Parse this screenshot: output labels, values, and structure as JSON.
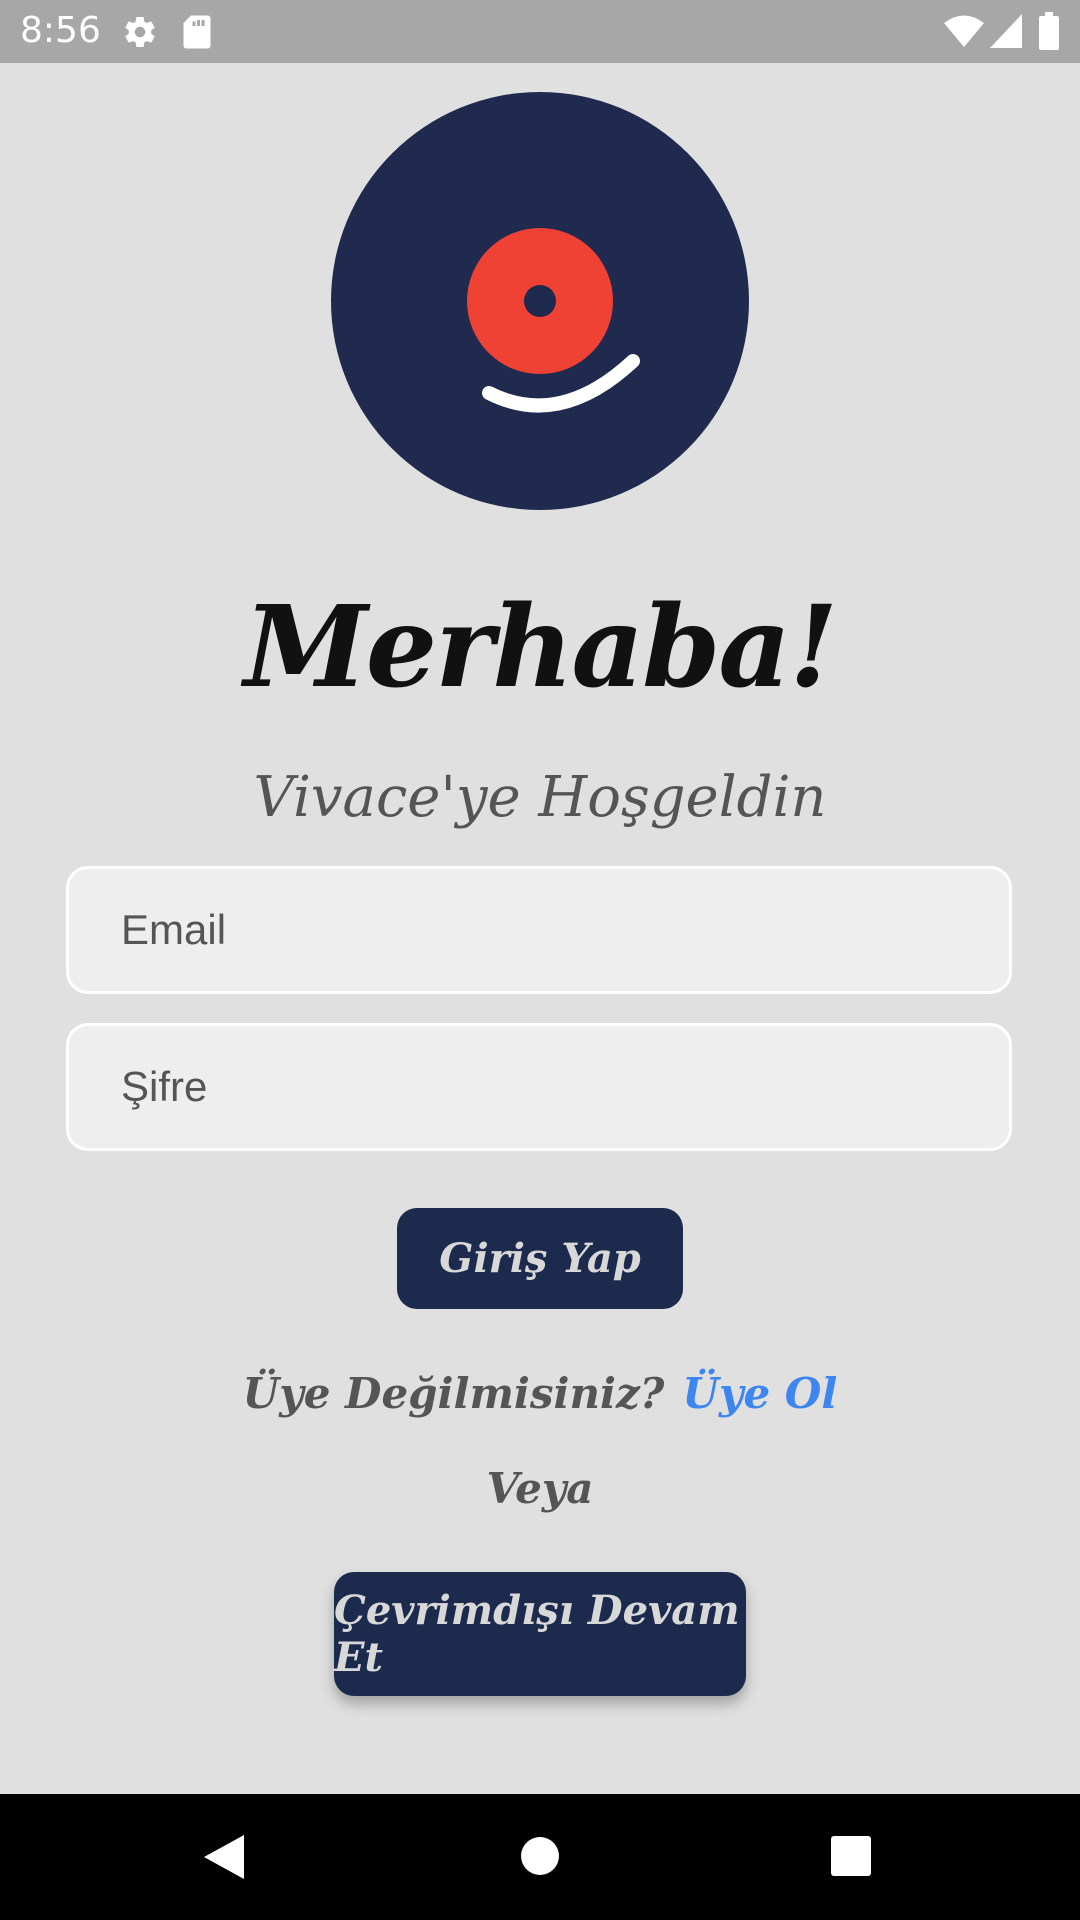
{
  "status_bar": {
    "time": "8:56",
    "icons": [
      "gear-icon",
      "sd-card-icon",
      "wifi-icon",
      "signal-icon",
      "battery-icon"
    ]
  },
  "app": {
    "logo": "vinyl-record-logo",
    "title": "Merhaba!",
    "subtitle": "Vivace'ye Hoşgeldin"
  },
  "form": {
    "email_placeholder": "Email",
    "password_placeholder": "Şifre",
    "login_button": "Giriş Yap"
  },
  "register": {
    "question": "Üye Değilmisiniz?",
    "link": "Üye Ol"
  },
  "divider_text": "Veya",
  "offline_button": "Çevrimdışı Devam Et",
  "nav_bar": {
    "icons": [
      "back-icon",
      "home-icon",
      "recents-icon"
    ]
  },
  "colors": {
    "primary": "#1c2a4d",
    "logo_background": "#1f2a4e",
    "logo_accent": "#ef4234",
    "link": "#3d86f0",
    "background": "#e0e0e0",
    "status_bar": "#a7a7a7"
  }
}
